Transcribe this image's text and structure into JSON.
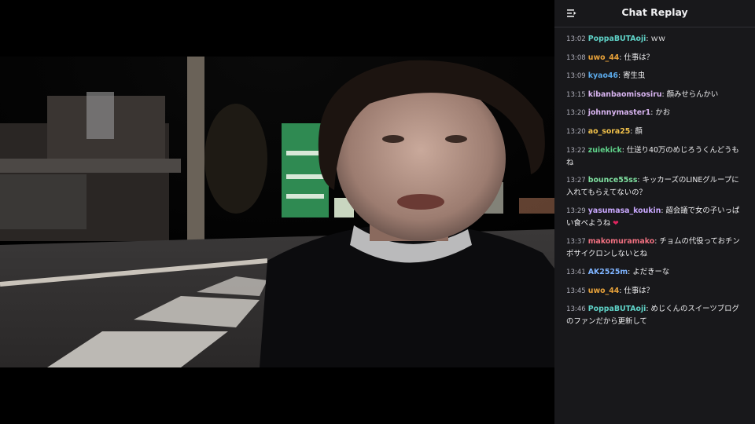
{
  "chat": {
    "title": "Chat Replay",
    "collapse_icon": "collapse-chat-icon",
    "messages": [
      {
        "time": "13:02",
        "user": "PoppaBUTAoji",
        "color": "#5fd3c8",
        "text": "ｗｗ"
      },
      {
        "time": "13:08",
        "user": "uwo_44",
        "color": "#e8a23a",
        "text": "仕事は？"
      },
      {
        "time": "13:09",
        "user": "kyao46",
        "color": "#5aa8e8",
        "text": "寄生虫"
      },
      {
        "time": "13:15",
        "user": "kibanbaomisosiru",
        "color": "#d8b4f0",
        "text": "顔みせらんかい"
      },
      {
        "time": "13:20",
        "user": "johnnymaster1",
        "color": "#d8b4f0",
        "text": "かお"
      },
      {
        "time": "13:20",
        "user": "ao_sora25",
        "color": "#f0c04a",
        "text": "顔"
      },
      {
        "time": "13:22",
        "user": "zuiekick",
        "color": "#5fd38a",
        "text": "仕送り40万のめじろうくんどうもね"
      },
      {
        "time": "13:27",
        "user": "bounce55ss",
        "color": "#7fe0a0",
        "text": "キッカーズのLINEグループに入れてもらえてないの？"
      },
      {
        "time": "13:29",
        "user": "yasumasa_koukin",
        "color": "#c9a8ff",
        "text": "超会議で女の子いっぱい食べようね",
        "emote": "broken-heart-icon"
      },
      {
        "time": "13:37",
        "user": "makomuramako",
        "color": "#f07080",
        "text": "チョムの代役っておチンポサイクロンしないとね"
      },
      {
        "time": "13:41",
        "user": "AK2525m",
        "color": "#7fb4ff",
        "text": "よだきーな"
      },
      {
        "time": "13:45",
        "user": "uwo_44",
        "color": "#e8a23a",
        "text": "仕事は？"
      },
      {
        "time": "13:46",
        "user": "PoppaBUTAoji",
        "color": "#5fd3c8",
        "text": "めじくんのスイーツブログのファンだから更新して"
      }
    ]
  },
  "video": {
    "scene": "night-street-selfie"
  }
}
